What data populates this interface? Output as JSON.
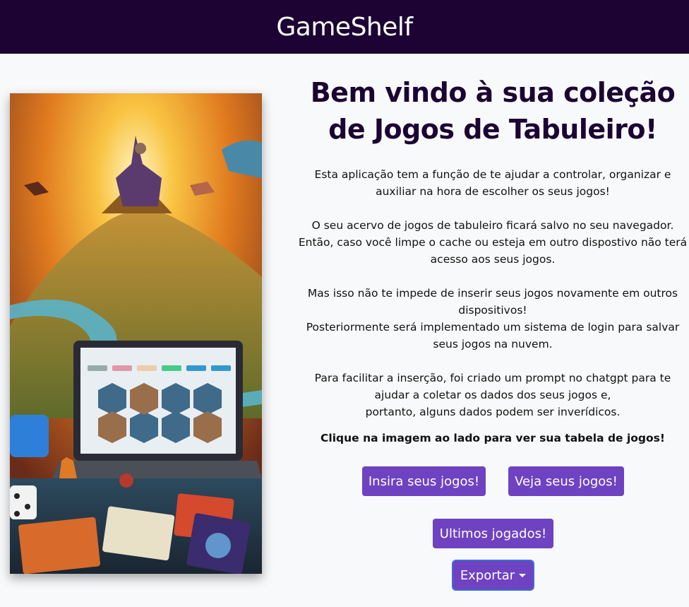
{
  "navbar": {
    "brand": "GameShelf"
  },
  "hero": {
    "image_alt": "Ilustração de fantasia com laptop exibindo jogos de tabuleiro",
    "icon": "board-game-illustration"
  },
  "main": {
    "title": "Bem vindo à sua coleção de Jogos de Tabuleiro!",
    "paragraphs": {
      "p1": "Esta aplicação tem a função de te ajudar a controlar, organizar e auxiliar na hora de escolher os seus jogos!",
      "p2a": "O seu acervo de jogos de tabuleiro ficará salvo no seu navegador.",
      "p2b": "Então, caso você limpe o cache ou esteja em outro dispostivo não terá acesso aos seus jogos.",
      "p3a": "Mas isso não te impede de inserir seus jogos novamente em outros dispositivos!",
      "p3b": "Posteriormente será implementado um sistema de login para salvar seus jogos na nuvem.",
      "p4a": "Para facilitar a inserção, foi criado um prompt no chatgpt para te ajudar a coletar os dados dos seus jogos e,",
      "p4b": "portanto, alguns dados podem ser inverídicos."
    },
    "cta": "Clique na imagem ao lado para ver sua tabela de jogos!"
  },
  "buttons": {
    "insert": "Insira seus jogos!",
    "view": "Veja seus jogos!",
    "recent": "Ultimos jogados!",
    "export": "Exportar"
  },
  "colors": {
    "navbar": "#1c0333",
    "accent": "#6f42c1",
    "title": "#1c0333"
  }
}
